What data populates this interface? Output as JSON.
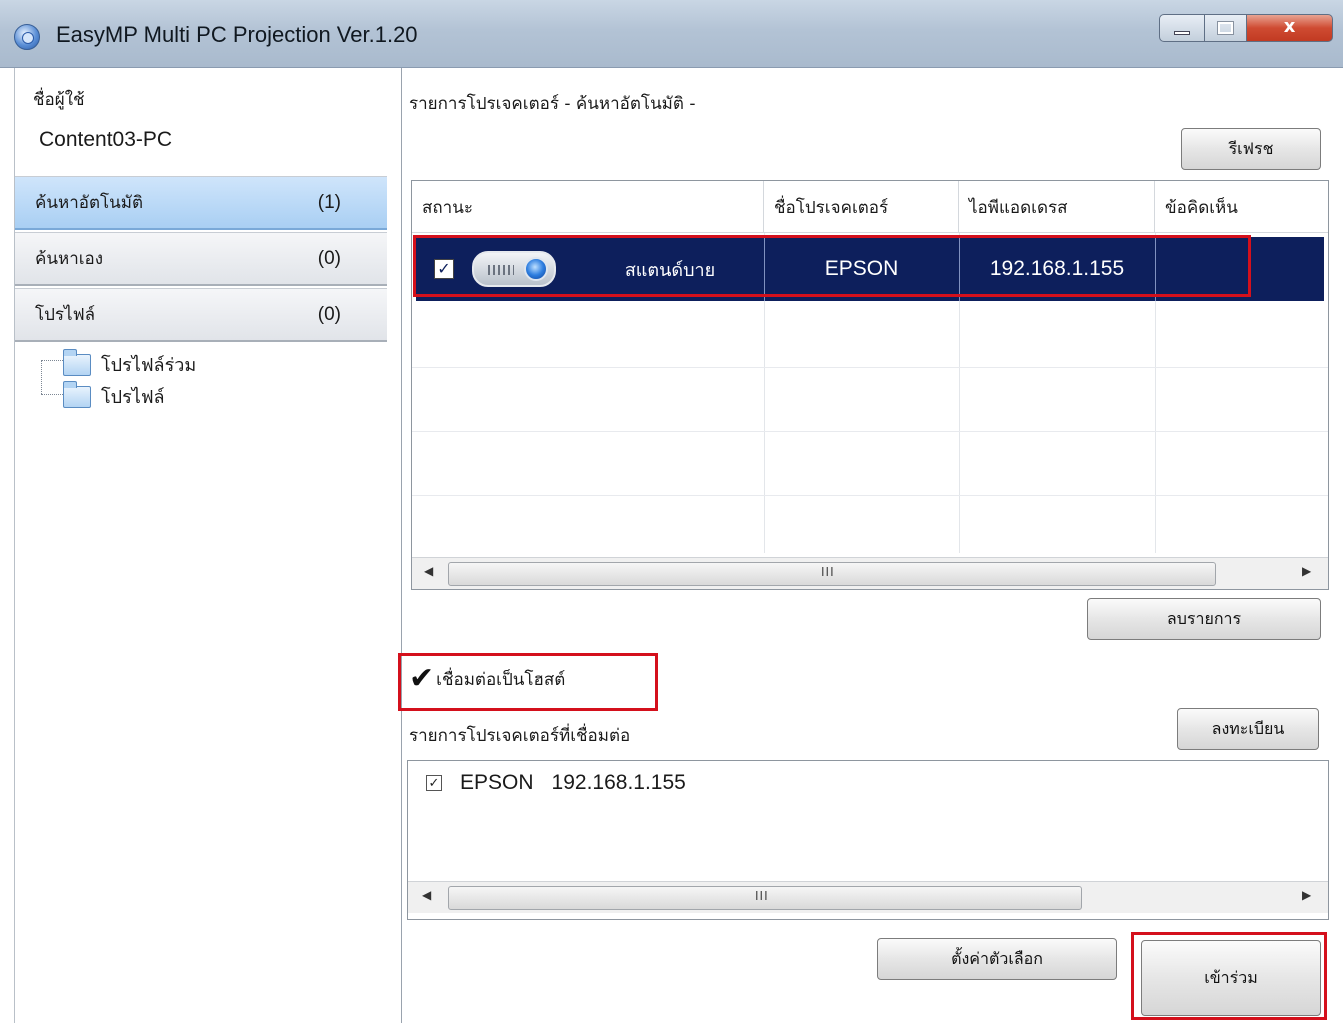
{
  "window": {
    "title": "EasyMP Multi PC Projection Ver.1.20",
    "close_glyph": "x"
  },
  "sidebar": {
    "user_label": "ชื่อผู้ใช้",
    "user_value": "Content03-PC",
    "items": [
      {
        "label": "ค้นหาอัตโนมัติ",
        "count": "(1)"
      },
      {
        "label": "ค้นหาเอง",
        "count": "(0)"
      },
      {
        "label": "โปรไฟล์",
        "count": "(0)"
      }
    ],
    "tree": [
      {
        "label": "โปรไฟล์ร่วม",
        "icon": "folder-icon"
      },
      {
        "label": "โปรไฟล์",
        "icon": "folder-open-icon"
      }
    ]
  },
  "main": {
    "list_title": "รายการโปรเจคเตอร์ - ค้นหาอัตโนมัติ -",
    "refresh_label": "รีเฟรช",
    "columns": [
      "สถานะ",
      "ชื่อโปรเจคเตอร์",
      "ไอพีแอดเดรส",
      "ข้อคิดเห็น"
    ],
    "rows": [
      {
        "checked": true,
        "icon": "projector-icon",
        "status": "สแตนด์บาย",
        "name": "EPSON",
        "ip": "192.168.1.155",
        "comment": ""
      }
    ],
    "scroll_grip": "III",
    "delete_list_label": "ลบรายการ",
    "connect_host_label": "เชื่อมต่อเป็นโฮสต์",
    "connected_title": "รายการโปรเจคเตอร์ที่เชื่อมต่อ",
    "register_label": "ลงทะเบียน",
    "connected": [
      {
        "checked": true,
        "name": "EPSON",
        "ip": "192.168.1.155"
      }
    ],
    "options_label": "ตั้งค่าตัวเลือก",
    "join_label": "เข้าร่วม"
  },
  "colors": {
    "selection": "#0d1f5c",
    "highlight": "#d4101c",
    "nav_active": "#a9cff3"
  }
}
